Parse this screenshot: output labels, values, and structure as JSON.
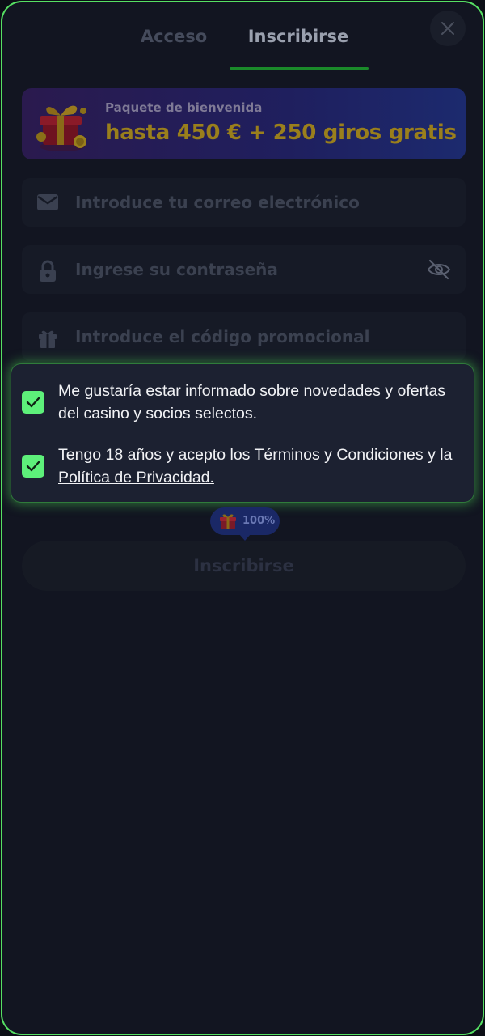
{
  "tabs": {
    "login_label": "Acceso",
    "signup_label": "Inscribirse"
  },
  "promo": {
    "subtitle": "Paquete de bienvenida",
    "headline": "hasta 450 € + 250 giros gratis"
  },
  "form": {
    "email_placeholder": "Introduce tu correo electrónico",
    "email_value": "",
    "password_placeholder": "Ingrese su contraseña",
    "password_value": "",
    "promo_code_placeholder": "Introduce el código promocional",
    "promo_code_value": ""
  },
  "consent": {
    "newsletter_text": "Me gustaría estar informado sobre novedades y ofertas del casino y socios selectos.",
    "newsletter_checked": true,
    "age_text_prefix": "Tengo 18 años y acepto los ",
    "terms_link": "Términos y Condiciones",
    "age_text_middle": " y ",
    "privacy_link": "la Política de Privacidad.",
    "age_checked": true
  },
  "progress_badge": {
    "label": "100%"
  },
  "submit_label": "Inscribirse",
  "colors": {
    "accent_green": "#5df07a",
    "frame_border": "#56e063",
    "promo_gold": "#9a7f1c"
  },
  "icons": {
    "close": "close-icon",
    "email": "envelope-icon",
    "password": "lock-icon",
    "password_toggle": "eye-slash-icon",
    "promo_code": "gift-icon",
    "checkbox": "checkmark-icon",
    "banner": "gift-box-icon"
  }
}
